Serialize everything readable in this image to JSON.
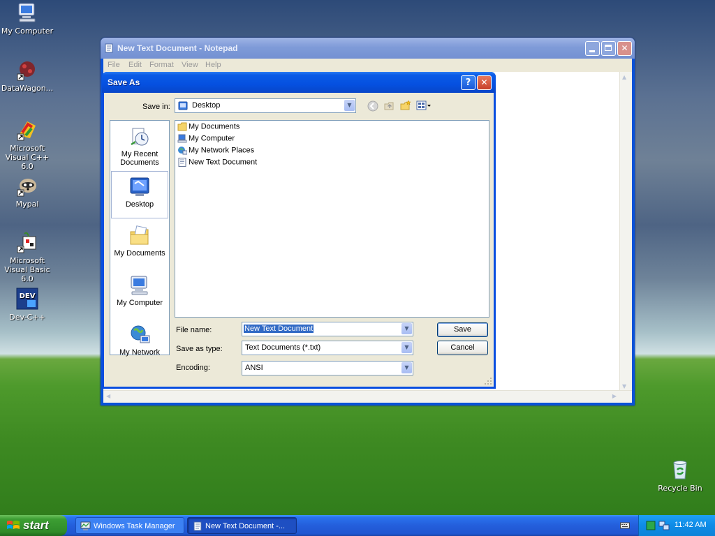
{
  "desktop": {
    "icons": [
      {
        "label": "My Computer"
      },
      {
        "label": "DataWagon..."
      },
      {
        "label": "Microsoft Visual C++ 6.0"
      },
      {
        "label": "Mypal"
      },
      {
        "label": "Microsoft Visual Basic 6.0"
      },
      {
        "label": "Dev-C++"
      },
      {
        "label": "Recycle Bin"
      }
    ],
    "icon_badge": "DEV"
  },
  "notepad": {
    "title": "New Text Document - Notepad",
    "menu": [
      "File",
      "Edit",
      "Format",
      "View",
      "Help"
    ]
  },
  "dialog": {
    "title": "Save As",
    "save_in_label": "Save in:",
    "save_in_value": "Desktop",
    "places": [
      {
        "label": "My Recent Documents"
      },
      {
        "label": "Desktop"
      },
      {
        "label": "My Documents"
      },
      {
        "label": "My Computer"
      },
      {
        "label": "My Network"
      }
    ],
    "files": [
      {
        "label": "My Documents"
      },
      {
        "label": "My Computer"
      },
      {
        "label": "My Network Places"
      },
      {
        "label": "New Text Document"
      }
    ],
    "file_name_label": "File name:",
    "file_name_value": "New Text Document",
    "save_type_label": "Save as type:",
    "save_type_value": "Text Documents (*.txt)",
    "encoding_label": "Encoding:",
    "encoding_value": "ANSI",
    "save_button": "Save",
    "cancel_button": "Cancel"
  },
  "taskbar": {
    "start_label": "start",
    "items": [
      {
        "label": "Windows Task Manager"
      },
      {
        "label": "New Text Document -..."
      }
    ],
    "clock": "11:42 AM"
  },
  "colors": {
    "titlebar_active": "#0550e0",
    "titlebar_inactive": "#7f9bd8",
    "dialog_face": "#ece9d8",
    "close_button": "#e0543a",
    "taskbar": "#245edb",
    "start_button": "#3c9e33"
  }
}
